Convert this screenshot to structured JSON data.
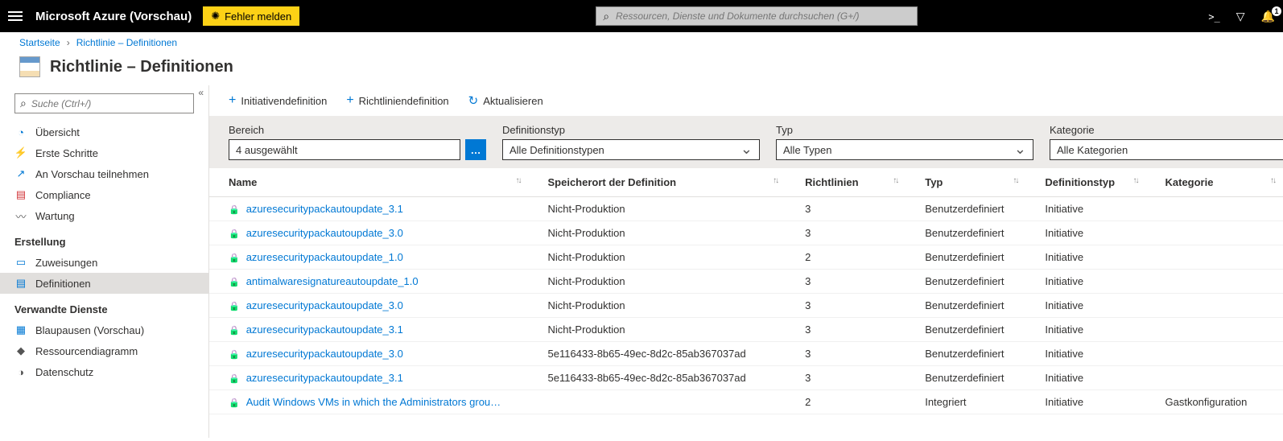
{
  "topbar": {
    "brand": "Microsoft Azure (Vorschau)",
    "bug_button": "Fehler melden",
    "search_placeholder": "Ressourcen, Dienste und Dokumente durchsuchen (G+/)",
    "notification_count": "1"
  },
  "crumbs": [
    {
      "label": "Startseite"
    },
    {
      "label": "Richtlinie – Definitionen"
    }
  ],
  "page_title": "Richtlinie – Definitionen",
  "sidebar": {
    "search_placeholder": "Suche (Ctrl+/)",
    "collapse_glyph": "«",
    "groups": [
      {
        "items": [
          {
            "icon": "ic-overview",
            "label": "Übersicht"
          },
          {
            "icon": "ic-started",
            "label": "Erste Schritte"
          },
          {
            "icon": "ic-preview",
            "label": "An Vorschau teilnehmen"
          },
          {
            "icon": "ic-compliance",
            "label": "Compliance"
          },
          {
            "icon": "ic-remediate",
            "label": "Wartung"
          }
        ]
      },
      {
        "header": "Erstellung",
        "items": [
          {
            "icon": "ic-assign",
            "label": "Zuweisungen"
          },
          {
            "icon": "ic-defs",
            "label": "Definitionen",
            "selected": true
          }
        ]
      },
      {
        "header": "Verwandte Dienste",
        "items": [
          {
            "icon": "ic-blueprint",
            "label": "Blaupausen (Vorschau)"
          },
          {
            "icon": "ic-graph",
            "label": "Ressourcendiagramm"
          },
          {
            "icon": "ic-privacy",
            "label": "Datenschutz"
          }
        ]
      }
    ]
  },
  "toolbar": {
    "initiative": "Initiativendefinition",
    "policy": "Richtliniendefinition",
    "refresh": "Aktualisieren"
  },
  "filters": {
    "scope": {
      "label": "Bereich",
      "value": "4 ausgewählt"
    },
    "deftype": {
      "label": "Definitionstyp",
      "value": "Alle Definitionstypen"
    },
    "type": {
      "label": "Typ",
      "value": "Alle Typen"
    },
    "category": {
      "label": "Kategorie",
      "value": "Alle Kategorien"
    }
  },
  "columns": {
    "name": "Name",
    "location": "Speicherort der Definition",
    "policies": "Richtlinien",
    "type": "Typ",
    "deftype": "Definitionstyp",
    "category": "Kategorie"
  },
  "rows": [
    {
      "name": "azuresecuritypackautoupdate_3.1",
      "location": "Nicht-Produktion",
      "policies": "3",
      "type": "Benutzerdefiniert",
      "deftype": "Initiative",
      "category": ""
    },
    {
      "name": "azuresecuritypackautoupdate_3.0",
      "location": "Nicht-Produktion",
      "policies": "3",
      "type": "Benutzerdefiniert",
      "deftype": "Initiative",
      "category": ""
    },
    {
      "name": "azuresecuritypackautoupdate_1.0",
      "location": "Nicht-Produktion",
      "policies": "2",
      "type": "Benutzerdefiniert",
      "deftype": "Initiative",
      "category": ""
    },
    {
      "name": "antimalwaresignatureautoupdate_1.0",
      "location": "Nicht-Produktion",
      "policies": "3",
      "type": "Benutzerdefiniert",
      "deftype": "Initiative",
      "category": ""
    },
    {
      "name": "azuresecuritypackautoupdate_3.0",
      "location": "Nicht-Produktion",
      "policies": "3",
      "type": "Benutzerdefiniert",
      "deftype": "Initiative",
      "category": ""
    },
    {
      "name": "azuresecuritypackautoupdate_3.1",
      "location": "Nicht-Produktion",
      "policies": "3",
      "type": "Benutzerdefiniert",
      "deftype": "Initiative",
      "category": ""
    },
    {
      "name": "azuresecuritypackautoupdate_3.0",
      "location": "5e116433-8b65-49ec-8d2c-85ab367037ad",
      "policies": "3",
      "type": "Benutzerdefiniert",
      "deftype": "Initiative",
      "category": ""
    },
    {
      "name": "azuresecuritypackautoupdate_3.1",
      "location": "5e116433-8b65-49ec-8d2c-85ab367037ad",
      "policies": "3",
      "type": "Benutzerdefiniert",
      "deftype": "Initiative",
      "category": ""
    },
    {
      "name": "Audit Windows VMs in which the Administrators grou…",
      "location": "",
      "policies": "2",
      "type": "Integriert",
      "deftype": "Initiative",
      "category": "Gastkonfiguration"
    }
  ]
}
